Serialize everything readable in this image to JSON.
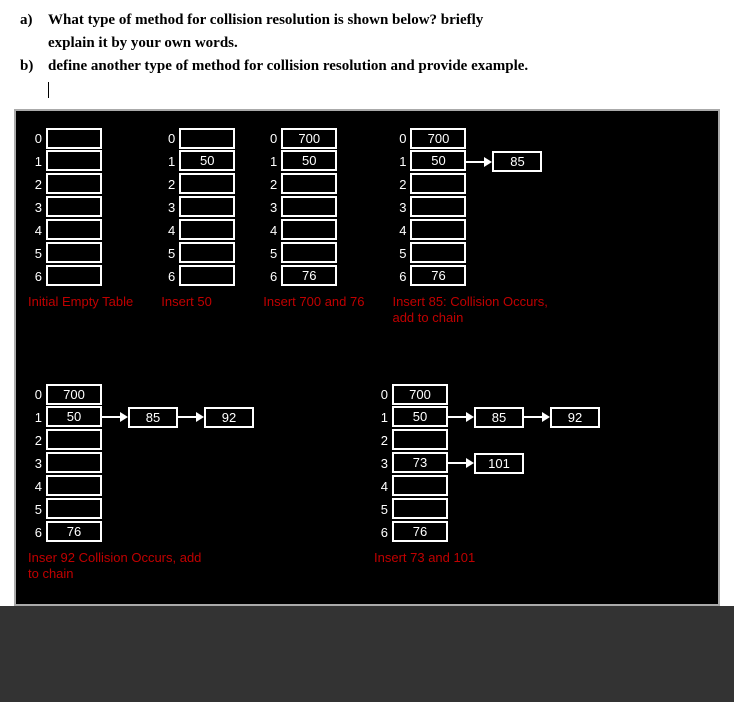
{
  "question": {
    "a_marker": "a)",
    "a_text_line1": "What type of method for collision resolution is shown below? briefly",
    "a_text_line2": "explain it by your own words.",
    "b_marker": "b)",
    "b_text": "define another type of method for collision resolution and provide example."
  },
  "indices": [
    "0",
    "1",
    "2",
    "3",
    "4",
    "5",
    "6"
  ],
  "row1": {
    "p1": {
      "cells": [
        "",
        "",
        "",
        "",
        "",
        "",
        ""
      ],
      "caption": "Initial Empty Table"
    },
    "p2": {
      "cells": [
        "",
        "50",
        "",
        "",
        "",
        "",
        ""
      ],
      "caption": "Insert 50"
    },
    "p3": {
      "cells": [
        "700",
        "50",
        "",
        "",
        "",
        "",
        "76"
      ],
      "caption": "Insert 700 and 76"
    },
    "p4": {
      "cells": [
        "700",
        "50",
        "",
        "",
        "",
        "",
        "76"
      ],
      "chain1": [
        "85"
      ],
      "caption": "Insert 85: Collision Occurs, add to chain"
    }
  },
  "row2": {
    "p5": {
      "cells": [
        "700",
        "50",
        "",
        "",
        "",
        "",
        "76"
      ],
      "chain1": [
        "85",
        "92"
      ],
      "caption": "Inser 92  Collision Occurs, add to chain"
    },
    "p6": {
      "cells": [
        "700",
        "50",
        "",
        "73",
        "",
        "",
        "76"
      ],
      "chain1": [
        "85",
        "92"
      ],
      "chain3": [
        "101"
      ],
      "caption": "Insert 73 and 101"
    }
  }
}
